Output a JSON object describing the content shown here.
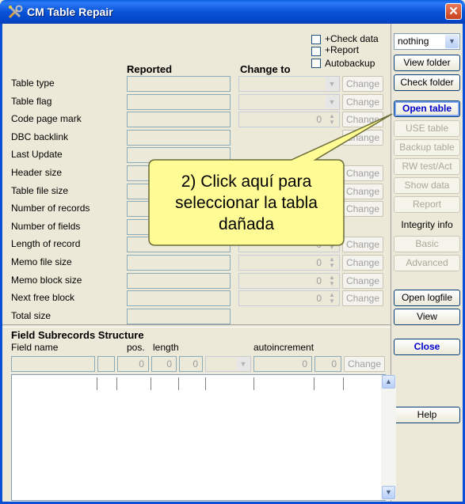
{
  "window": {
    "title": "CM Table Repair",
    "close": "✕"
  },
  "options": {
    "check_data": "+Check data",
    "report": "+Report",
    "autobackup": "Autobackup",
    "select_value": "nothing"
  },
  "headers": {
    "reported": "Reported",
    "change_to": "Change to"
  },
  "rows": [
    {
      "label": "Table type",
      "value": "",
      "editor": "combo",
      "change": "Change"
    },
    {
      "label": "Table flag",
      "value": "",
      "editor": "combo",
      "change": "Change"
    },
    {
      "label": "Code page mark",
      "value": "0",
      "editor": "spin",
      "change": "Change"
    },
    {
      "label": "DBC backlink",
      "value": "",
      "editor": "none",
      "change": "Change"
    },
    {
      "label": "Last Update",
      "value": "",
      "editor": "none",
      "change": ""
    },
    {
      "label": "Header size",
      "value": "",
      "editor": "none",
      "change": "Change"
    },
    {
      "label": "Table file size",
      "value": "",
      "editor": "none",
      "change": "Change"
    },
    {
      "label": "Number of records",
      "value": "",
      "editor": "none",
      "change": "Change"
    },
    {
      "label": "Number of fields",
      "value": "",
      "editor": "none",
      "change": ""
    },
    {
      "label": "Length of record",
      "value": "0",
      "editor": "spin",
      "change": "Change"
    },
    {
      "label": "Memo file size",
      "value": "0",
      "editor": "spin",
      "change": "Change"
    },
    {
      "label": "Memo block size",
      "value": "0",
      "editor": "spin",
      "change": "Change"
    },
    {
      "label": "Next free block",
      "value": "0",
      "editor": "spin",
      "change": "Change"
    },
    {
      "label": "Total size",
      "value": "",
      "editor": "none",
      "change": ""
    }
  ],
  "buttons": {
    "view_folder": "View folder",
    "check_folder": "Check folder",
    "open_table": "Open table",
    "use_table": "USE table",
    "backup_table": "Backup table",
    "rw_test": "RW test/Act",
    "show_data": "Show data",
    "report": "Report",
    "integrity_info": "Integrity info",
    "basic": "Basic",
    "advanced": "Advanced",
    "open_logfile": "Open logfile",
    "view": "View",
    "close": "Close",
    "help": "Help"
  },
  "field_section": {
    "title": "Field Subrecords Structure",
    "col_field_name": "Field name",
    "col_pos": "pos.",
    "col_length": "length",
    "col_autoincrement": "autoincrement",
    "v1": "0",
    "v2": "0",
    "v3": "0",
    "v4": "0",
    "v5": "0",
    "change": "Change"
  },
  "callout": {
    "line1": "2) Click aquí para",
    "line2": "seleccionar la tabla",
    "line3": "dañada"
  }
}
